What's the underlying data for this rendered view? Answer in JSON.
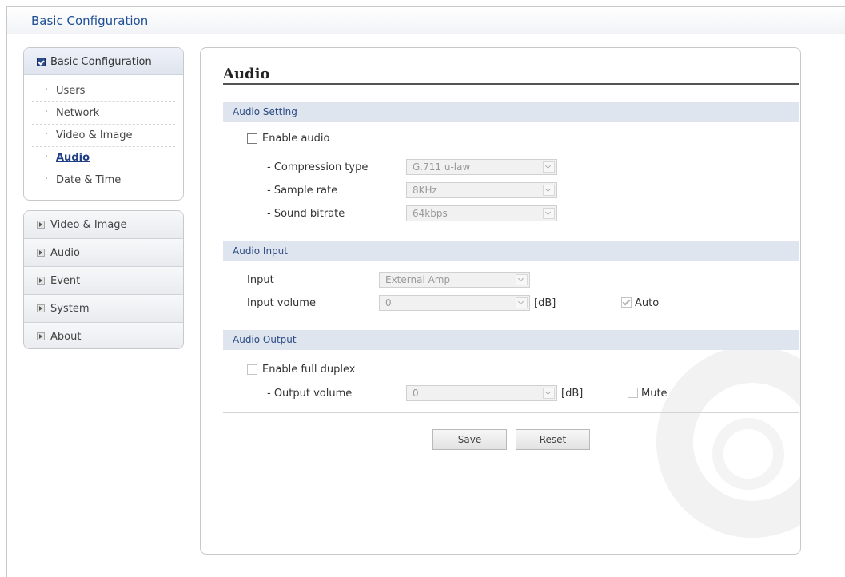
{
  "header": {
    "title": "Basic Configuration"
  },
  "sidebar": {
    "open_section": {
      "label": "Basic Configuration",
      "items": [
        {
          "label": "Users",
          "active": false
        },
        {
          "label": "Network",
          "active": false
        },
        {
          "label": "Video & Image",
          "active": false
        },
        {
          "label": "Audio",
          "active": true
        },
        {
          "label": "Date & Time",
          "active": false
        }
      ]
    },
    "sections": [
      {
        "label": "Video & Image"
      },
      {
        "label": "Audio"
      },
      {
        "label": "Event"
      },
      {
        "label": "System"
      },
      {
        "label": "About"
      }
    ]
  },
  "main": {
    "title": "Audio",
    "audio_setting": {
      "heading": "Audio Setting",
      "enable_label": "Enable audio",
      "compression_label": "- Compression type",
      "compression_value": "G.711 u-law",
      "sample_rate_label": "- Sample rate",
      "sample_rate_value": "8KHz",
      "bitrate_label": "- Sound bitrate",
      "bitrate_value": "64kbps"
    },
    "audio_input": {
      "heading": "Audio Input",
      "input_label": "Input",
      "input_value": "External Amp",
      "volume_label": "Input volume",
      "volume_value": "0",
      "unit": "[dB]",
      "auto_label": "Auto"
    },
    "audio_output": {
      "heading": "Audio Output",
      "duplex_label": "Enable full duplex",
      "volume_label": "- Output volume",
      "volume_value": "0",
      "unit": "[dB]",
      "mute_label": "Mute"
    },
    "buttons": {
      "save": "Save",
      "reset": "Reset"
    }
  }
}
